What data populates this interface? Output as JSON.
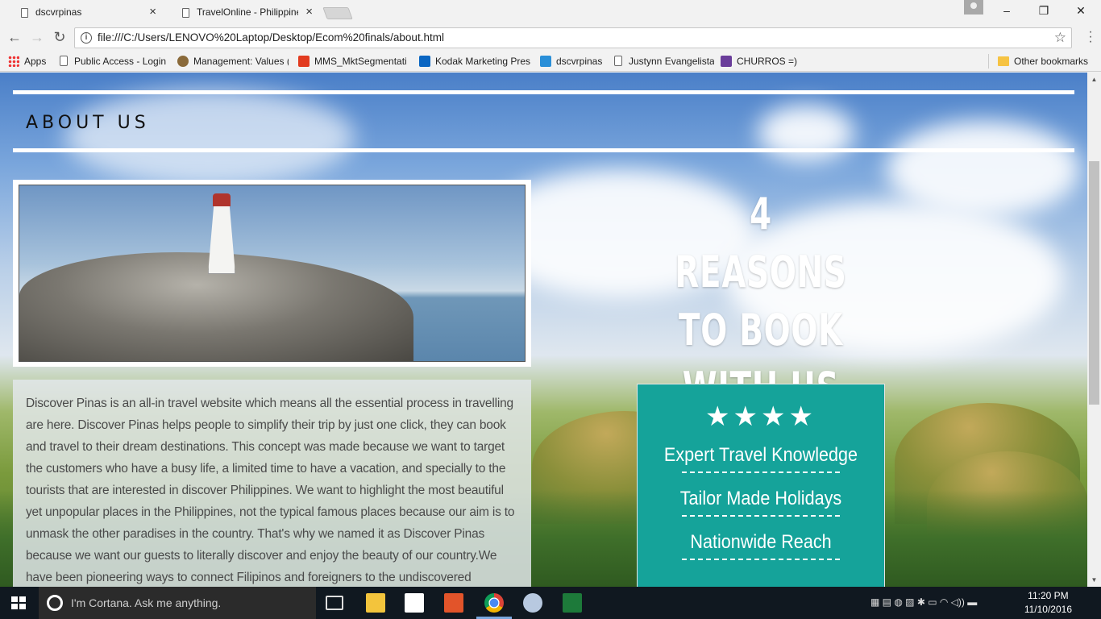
{
  "tabs": [
    {
      "title": "dscvrpinas",
      "close": "×"
    },
    {
      "title": "TravelOnline - Philippines",
      "close": "×"
    }
  ],
  "window_controls": {
    "minimize": "–",
    "restore": "❐",
    "close": "✕"
  },
  "toolbar": {
    "back": "←",
    "forward": "→",
    "reload": "↻",
    "url": "file:///C:/Users/LENOVO%20Laptop/Desktop/Ecom%20finals/about.html",
    "info": "i",
    "star": "☆",
    "menu": "⋮"
  },
  "bookmarks": {
    "items": [
      {
        "label": "Apps",
        "icon": "apps-grid-icon"
      },
      {
        "label": "Public Access - Login",
        "icon": "page-icon"
      },
      {
        "label": "Management: Values (",
        "icon": "management-icon"
      },
      {
        "label": "MMS_MktSegmentati",
        "icon": "mms-icon"
      },
      {
        "label": "Kodak Marketing Pres",
        "icon": "linkedin-icon"
      },
      {
        "label": "dscvrpinas",
        "icon": "dscvr-icon"
      },
      {
        "label": "Justynn Evangelista",
        "icon": "page-icon"
      },
      {
        "label": "CHURROS =)",
        "icon": "churros-icon"
      }
    ],
    "other": "Other bookmarks"
  },
  "page": {
    "heading": "ABOUT US",
    "about_text": "Discover Pinas is an all-in travel website which means all the essential process in travelling are here. Discover Pinas helps people to simplify their trip by just one click, they can book and travel to their dream destinations. This concept was made because we want to target the customers who have a busy life, a limited time to have a vacation, and specially to the tourists that are interested in discover Philippines. We want to highlight the most beautiful yet unpopular places in the Philippines, not the typical famous places because our aim is to unmask the other paradises in the country. That's why we named it as Discover Pinas because we want our guests to literally discover and enjoy the beauty of our country.We have been pioneering ways to connect Filipinos and foreigners to the undiscovered",
    "reasons_title": [
      "4 REASONS",
      "TO BOOK",
      "WITH US"
    ],
    "stars": "★★★★",
    "reasons": [
      "Expert Travel Knowledge",
      "Tailor Made Holidays",
      "Nationwide Reach"
    ]
  },
  "taskbar": {
    "cortana_placeholder": "I'm Cortana. Ask me anything.",
    "time": "11:20 PM",
    "date": "11/10/2016"
  }
}
